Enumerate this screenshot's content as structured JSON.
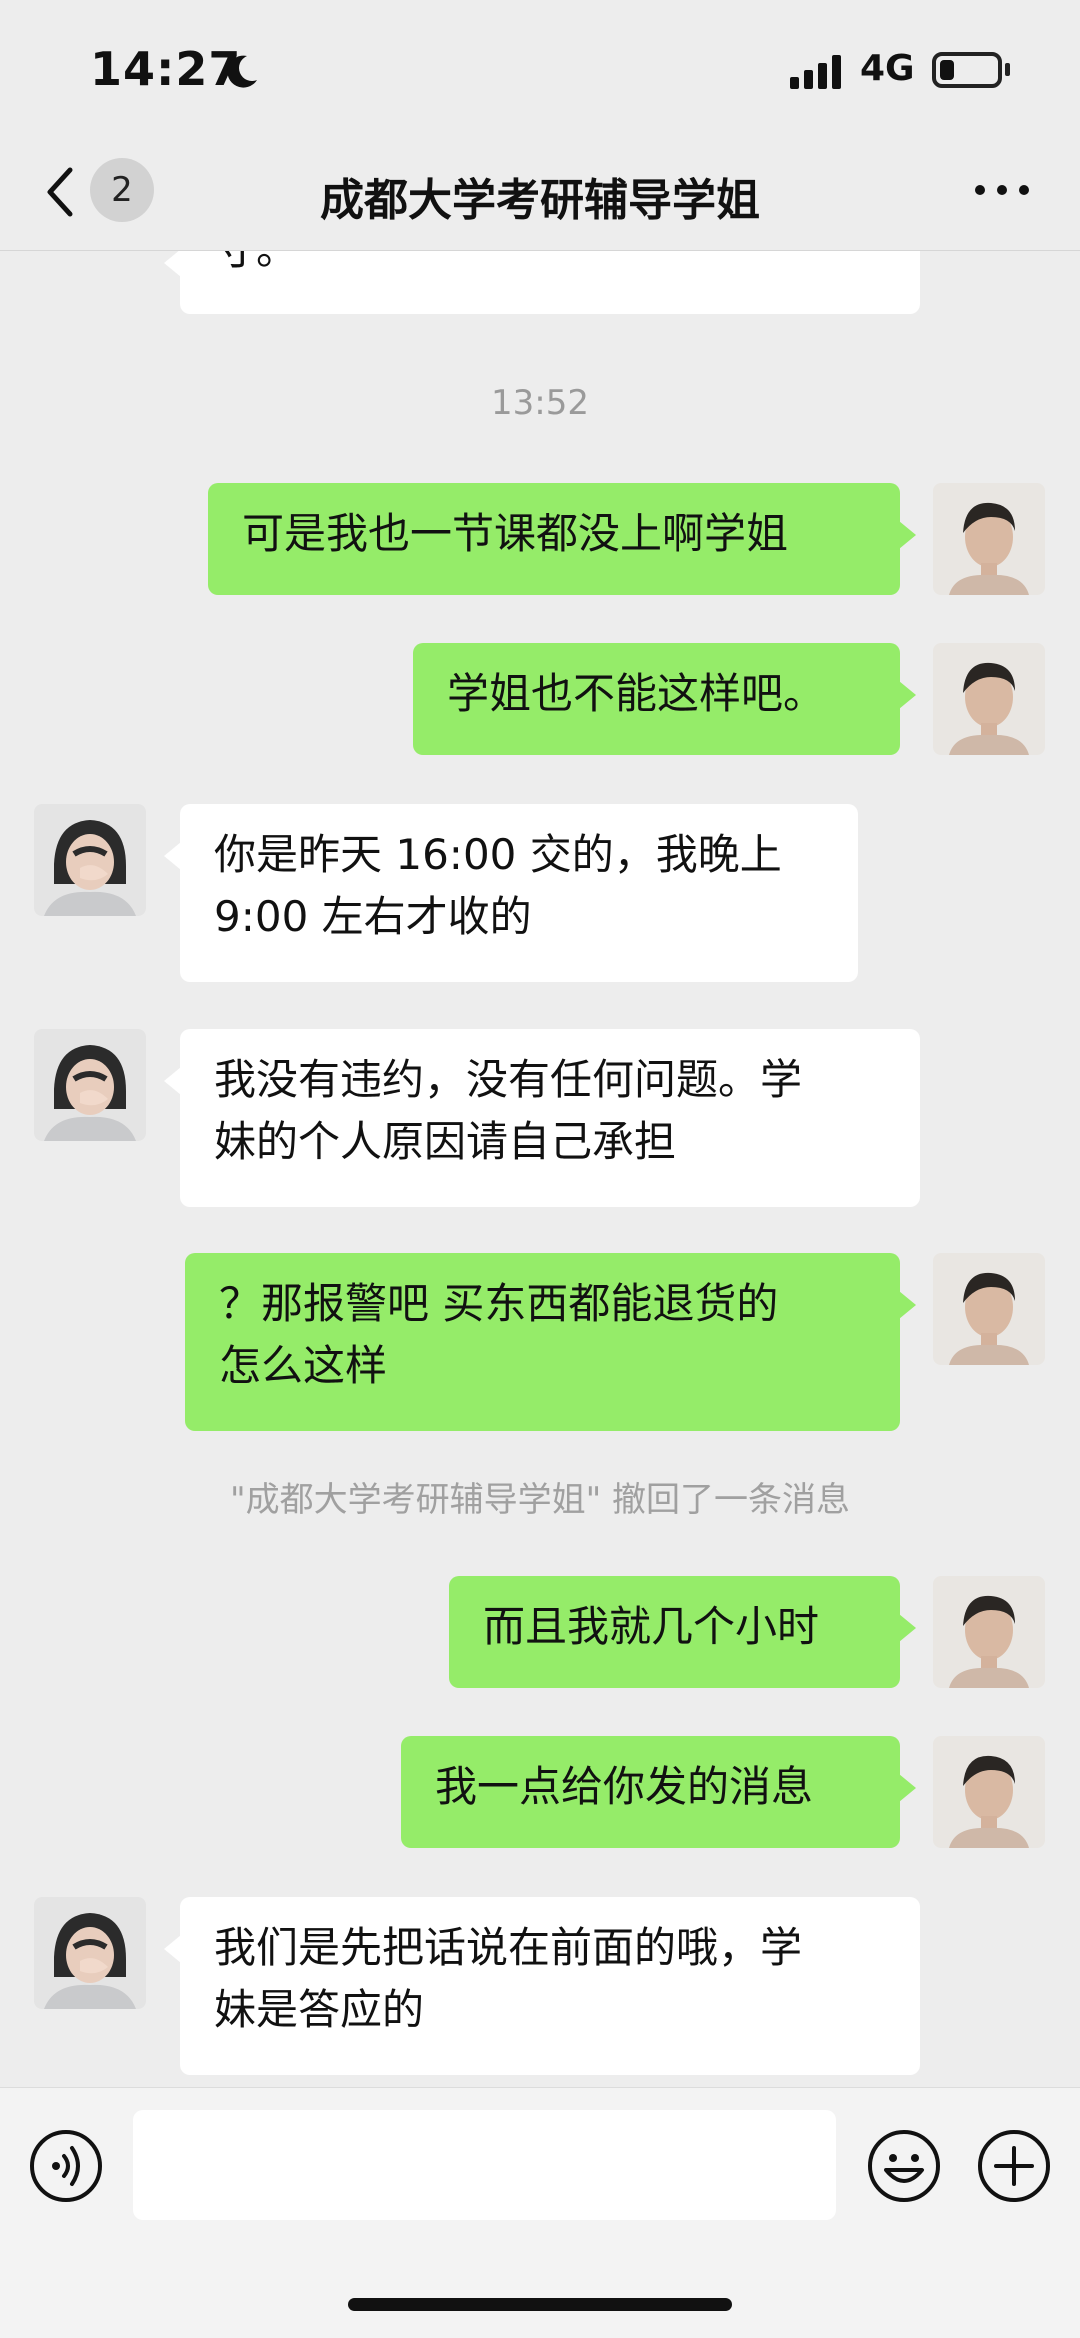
{
  "status_bar": {
    "time": "14:27",
    "network": "4G"
  },
  "nav": {
    "unread_count": "2",
    "title": "成都大学考研辅导学姐"
  },
  "chat": {
    "partial_message": "寸。",
    "timestamp": "13:52",
    "messages": [
      {
        "side": "out",
        "text": "可是我也一节课都没上啊学姐"
      },
      {
        "side": "out",
        "text": "学姐也不能这样吧。"
      },
      {
        "side": "in",
        "line1": "你是昨天 16:00 交的，我晚上",
        "line2": "9:00 左右才收的"
      },
      {
        "side": "in",
        "line1": "我没有违约，没有任何问题。学",
        "line2": "妹的个人原因请自己承担"
      },
      {
        "side": "out",
        "line1": "？那报警吧 买东西都能退货的",
        "line2": "怎么这样"
      },
      {
        "side": "out",
        "text": "而且我就几个小时"
      },
      {
        "side": "out",
        "text": "我一点给你发的消息"
      },
      {
        "side": "in",
        "line1": "我们是先把话说在前面的哦，学",
        "line2": "妹是答应的"
      }
    ],
    "recall_notice": "\"成都大学考研辅导学姐\" 撤回了一条消息"
  },
  "input_bar": {
    "placeholder": ""
  },
  "icons": [
    "moon-icon",
    "signal-icon",
    "battery-icon",
    "back-chevron-icon",
    "more-dots-icon",
    "voice-icon",
    "emoji-icon",
    "plus-icon"
  ],
  "colors": {
    "background": "#ededed",
    "outgoing_bubble": "#95ec69",
    "incoming_bubble": "#ffffff"
  }
}
